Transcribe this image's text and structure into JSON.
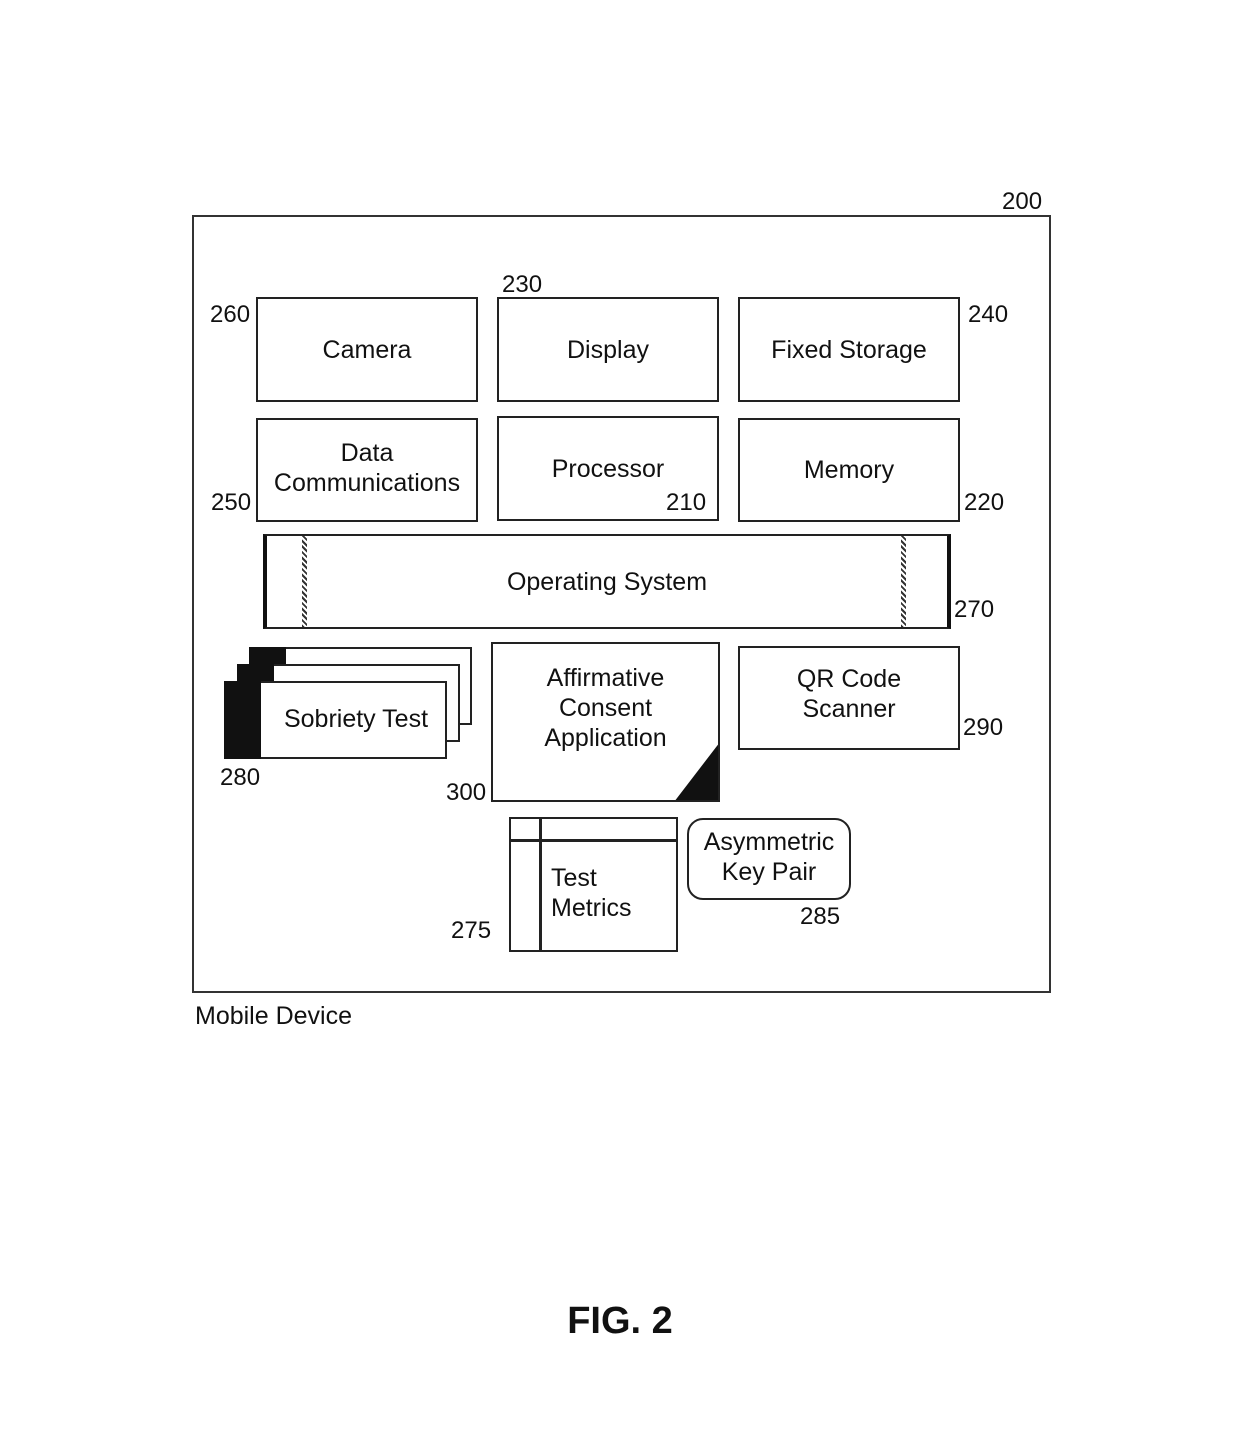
{
  "device": {
    "label": "Mobile Device",
    "ref": "200"
  },
  "components": {
    "camera": {
      "label": "Camera",
      "ref": "260"
    },
    "display": {
      "label": "Display",
      "ref": "230"
    },
    "fixed_storage": {
      "label": "Fixed Storage",
      "ref": "240"
    },
    "data_communications": {
      "label_line1": "Data",
      "label_line2": "Communications",
      "ref": "250"
    },
    "processor": {
      "label": "Processor",
      "ref": "210"
    },
    "memory": {
      "label": "Memory",
      "ref": "220"
    },
    "operating_system": {
      "label": "Operating System",
      "ref": "270"
    },
    "sobriety_test": {
      "label": "Sobriety Test",
      "ref": "280"
    },
    "affirmative_consent_application": {
      "label_line1": "Affirmative",
      "label_line2": "Consent",
      "label_line3": "Application",
      "ref": "300"
    },
    "qr_code_scanner": {
      "label_line1": "QR Code",
      "label_line2": "Scanner",
      "ref": "290"
    },
    "test_metrics": {
      "label_line1": "Test",
      "label_line2": "Metrics",
      "ref": "275"
    },
    "asymmetric_key_pair": {
      "label_line1": "Asymmetric",
      "label_line2": "Key Pair",
      "ref": "285"
    }
  },
  "figure": {
    "caption": "FIG. 2"
  }
}
